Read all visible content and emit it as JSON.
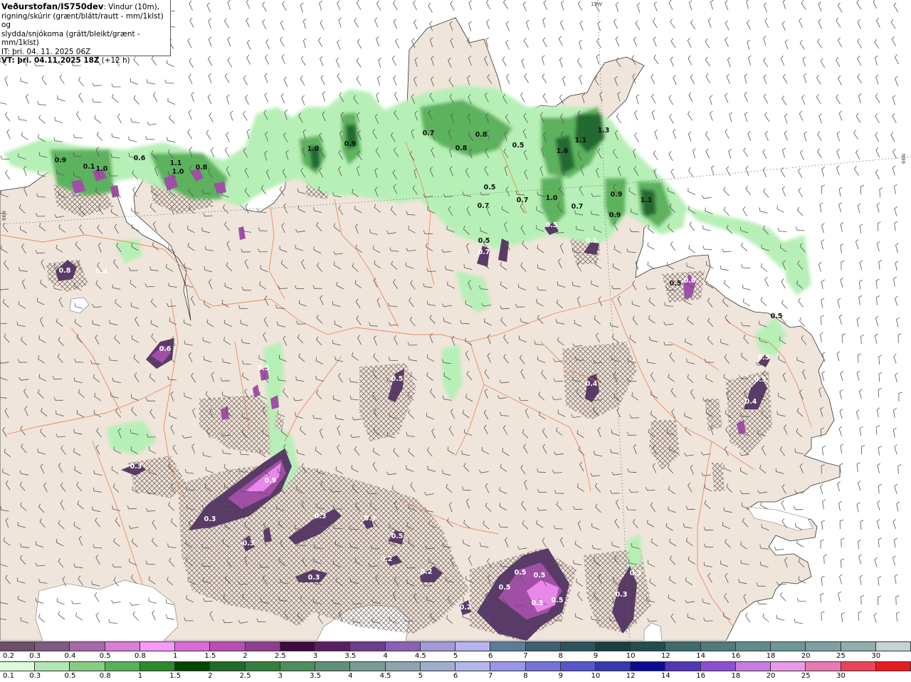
{
  "header": {
    "source": "Veðurstofan/IS750dev",
    "description_1": ": Vindur (10m),",
    "description_2": "rigning/skúrir (grænt/blátt/rautt - mm/1klst) og",
    "description_3": "slydda/snjókoma (grátt/bleikt/grænt - mm/1klst)",
    "init_time": "IT: þri. 04. 11. 2025 06Z",
    "valid_prefix": "VT: þri. 04.11.2025 18Z",
    "valid_suffix": " (+12 h)"
  },
  "grid_labels": {
    "top": "15W",
    "right": "66N",
    "left": "66N"
  },
  "colors": {
    "land": "#f0e5da",
    "sea": "#ffffff",
    "snow_hatch": "#6b5a55",
    "green_light": "#b7f0b7",
    "green_mid": "#5db35d",
    "green_dark": "#226b33",
    "purple_light": "#e888e8",
    "purple_mid": "#a14fa6",
    "purple_dark": "#5a3a66",
    "roads": "#e8815a"
  },
  "legend_snow": {
    "labels": [
      "0.2",
      "0.3",
      "0.4",
      "0.5",
      "0.8",
      "1",
      "1.5",
      "2",
      "2.5",
      "3",
      "3.5",
      "4",
      "4.5",
      "5",
      "6",
      "7",
      "8",
      "9",
      "10",
      "12",
      "14",
      "16",
      "18",
      "20",
      "25",
      "30"
    ],
    "colors": [
      "#6b4f6b",
      "#7e5b80",
      "#a469a8",
      "#d77fd8",
      "#f59af5",
      "#d86bd6",
      "#b84fb6",
      "#8d3f8d",
      "#3d0b3d",
      "#5a1f62",
      "#6d3d8e",
      "#8a62b4",
      "#a49ad7",
      "#b7b4f0",
      "#5b7d9a",
      "#3e6071",
      "#2b555e",
      "#1a3f40",
      "#244d4d",
      "#3f6b6b",
      "#527a7a",
      "#638b8b",
      "#709797",
      "#80a0a0",
      "#93adad",
      "#c7d2d2"
    ]
  },
  "legend_rain": {
    "labels": [
      "0.1",
      "0.3",
      "0.5",
      "0.8",
      "1",
      "1.5",
      "2",
      "2.5",
      "3",
      "3.5",
      "4",
      "4.5",
      "5",
      "6",
      "7",
      "8",
      "9",
      "10",
      "12",
      "14",
      "16",
      "18",
      "20",
      "25",
      "30"
    ],
    "colors": [
      "#dcfadc",
      "#b2e6b2",
      "#86cc86",
      "#5bb05b",
      "#2d8a2d",
      "#004800",
      "#1f6b2a",
      "#33803f",
      "#4b8f5a",
      "#608f7a",
      "#7a9a95",
      "#8ea5b0",
      "#a0aecb",
      "#b4b6ea",
      "#9a97e6",
      "#7474d8",
      "#5656c8",
      "#3838ae",
      "#0b0b94",
      "#5237b5",
      "#8c4fd1",
      "#c47ee0",
      "#e79ae8",
      "#e77ab0",
      "#e8445a",
      "#e81b22"
    ]
  },
  "map_labels": {
    "rain": [
      {
        "t": "0.9"
      },
      {
        "t": "0.1"
      },
      {
        "t": "1.0"
      },
      {
        "t": "0.6"
      },
      {
        "t": "1.1"
      },
      {
        "t": "0.8"
      },
      {
        "t": "1.0"
      },
      {
        "t": "1.0"
      },
      {
        "t": "0.9"
      },
      {
        "t": "0.7"
      },
      {
        "t": "0.8"
      },
      {
        "t": "0.8"
      },
      {
        "t": "0.5"
      },
      {
        "t": "1.6"
      },
      {
        "t": "1.1"
      },
      {
        "t": "1.3"
      },
      {
        "t": "0.5"
      },
      {
        "t": "0.7"
      },
      {
        "t": "0.7"
      },
      {
        "t": "1.0"
      },
      {
        "t": "0.7"
      },
      {
        "t": "0.9"
      },
      {
        "t": "0.9"
      },
      {
        "t": "1.1"
      },
      {
        "t": "0.5"
      },
      {
        "t": "0.5"
      },
      {
        "t": "0.5"
      }
    ],
    "snow": [
      {
        "t": "0.8"
      },
      {
        "t": "0.4"
      },
      {
        "t": "0.6"
      },
      {
        "t": "0.5"
      },
      {
        "t": "0.5"
      },
      {
        "t": "0.5"
      },
      {
        "t": "0.7"
      },
      {
        "t": "0.5"
      },
      {
        "t": "0.8"
      },
      {
        "t": "0.4"
      },
      {
        "t": "0.5"
      },
      {
        "t": "0.5"
      },
      {
        "t": "0.4"
      },
      {
        "t": "0.3"
      },
      {
        "t": "0.9"
      },
      {
        "t": "0.3"
      },
      {
        "t": "0.3"
      },
      {
        "t": "0.3"
      },
      {
        "t": "0.5"
      },
      {
        "t": "0.2"
      },
      {
        "t": "0.3"
      },
      {
        "t": "0.2"
      },
      {
        "t": "0.5"
      },
      {
        "t": "0.5"
      },
      {
        "t": "0.5"
      },
      {
        "t": "0.5"
      },
      {
        "t": "0.5"
      },
      {
        "t": "0.3"
      },
      {
        "t": "0.3"
      },
      {
        "t": "0.2"
      },
      {
        "t": "0.3"
      }
    ]
  }
}
